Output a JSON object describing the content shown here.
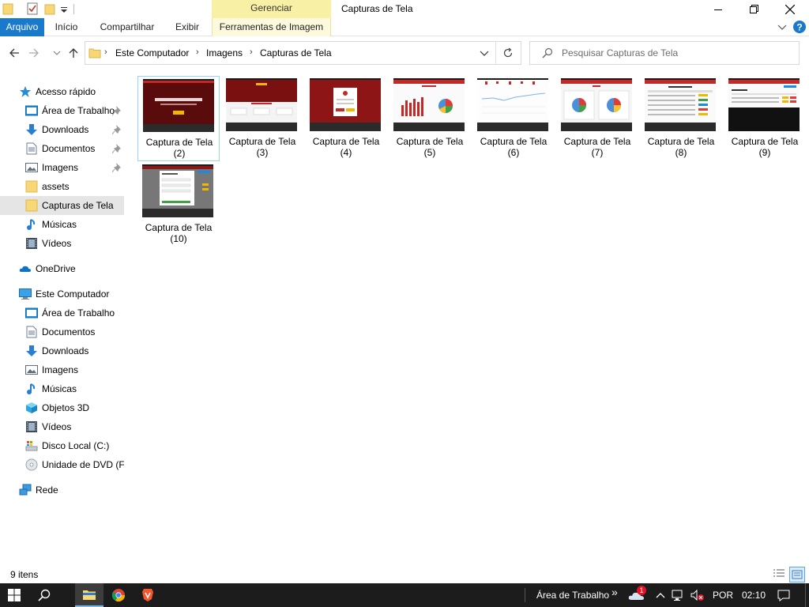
{
  "window": {
    "title": "Capturas de Tela",
    "context_header": "Gerenciar"
  },
  "ribbon": {
    "tabs": [
      "Arquivo",
      "Início",
      "Compartilhar",
      "Exibir"
    ],
    "context_tab": "Ferramentas de Imagem"
  },
  "address": {
    "crumbs": [
      "Este Computador",
      "Imagens",
      "Capturas de Tela"
    ]
  },
  "search": {
    "placeholder": "Pesquisar Capturas de Tela"
  },
  "sidebar": {
    "quick_access": "Acesso rápido",
    "quick_items": [
      "Área de Trabalho",
      "Downloads",
      "Documentos",
      "Imagens",
      "assets",
      "Capturas de Tela",
      "Músicas",
      "Vídeos"
    ],
    "onedrive": "OneDrive",
    "this_pc": "Este Computador",
    "pc_items": [
      "Área de Trabalho",
      "Documentos",
      "Downloads",
      "Imagens",
      "Músicas",
      "Objetos 3D",
      "Vídeos",
      "Disco Local (C:)",
      "Unidade de DVD (F:)"
    ],
    "network": "Rede"
  },
  "files": [
    {
      "line1": "Captura de Tela",
      "line2": "(2)"
    },
    {
      "line1": "Captura de Tela",
      "line2": "(3)"
    },
    {
      "line1": "Captura de Tela",
      "line2": "(4)"
    },
    {
      "line1": "Captura de Tela",
      "line2": "(5)"
    },
    {
      "line1": "Captura de Tela",
      "line2": "(6)"
    },
    {
      "line1": "Captura de Tela",
      "line2": "(7)"
    },
    {
      "line1": "Captura de Tela",
      "line2": "(8)"
    },
    {
      "line1": "Captura de Tela",
      "line2": "(9)"
    },
    {
      "line1": "Captura de Tela",
      "line2": "(10)"
    }
  ],
  "status": {
    "count": "9 itens"
  },
  "taskbar": {
    "desktop_label": "Área de Trabalho",
    "language": "POR",
    "time": "02:10",
    "notification_badge": "1"
  },
  "colors": {
    "accent": "#1979ca",
    "context_tab": "#f8f1a5",
    "selection": "#cce8ff",
    "folder": "#f8d775",
    "taskbar": "#1c1c1c"
  }
}
